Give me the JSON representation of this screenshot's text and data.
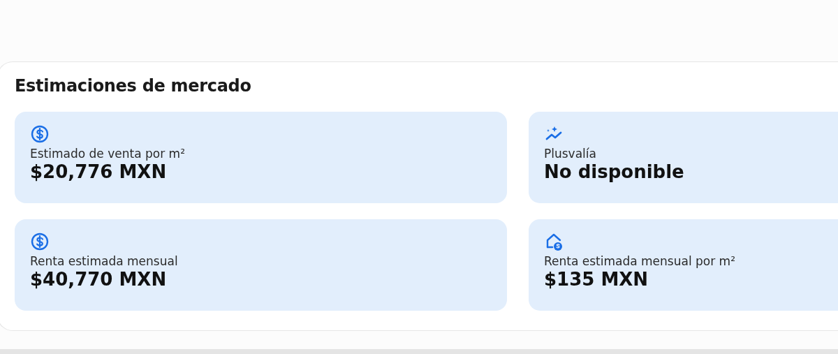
{
  "section": {
    "title": "Estimaciones de mercado"
  },
  "estimates": [
    {
      "kind": "sale",
      "label": "Estimado de venta por m²",
      "value": "$20,776 MXN"
    },
    {
      "kind": "appreciation",
      "label": "Plusvalía",
      "value": "No disponible"
    },
    {
      "kind": "rent",
      "label": "Renta estimada mensual",
      "value": "$40,770 MXN"
    },
    {
      "kind": "rent-area",
      "label": "Renta estimada mensual por m²",
      "value": "$135 MXN"
    }
  ]
}
